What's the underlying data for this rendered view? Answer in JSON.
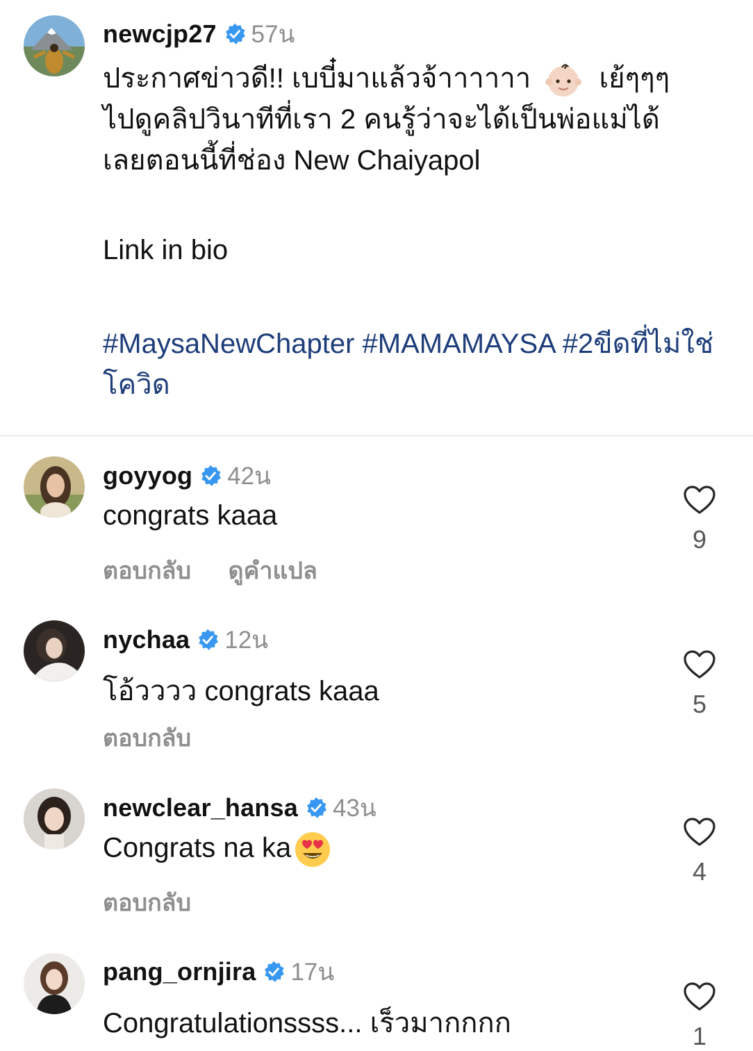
{
  "post": {
    "username": "newcjp27",
    "time": "57น",
    "caption_lines": [
      "ประกาศข่าวดี!! เบบี๋มาแล้วจ้าาาาาา",
      "เย้ๆๆๆ",
      "ไปดูคลิปวินาทีที่เรา 2 คนรู้ว่าจะได้เป็นพ่อแม่ได้",
      "เลยตอนนี้ที่ช่อง New Chaiyapol"
    ],
    "link_text": "Link in bio",
    "hashtags": [
      "#MaysaNewChapter",
      "#MAMAMAYSA",
      "#2ขีดที่ไม่ใช่โควิด"
    ],
    "emoji_icon": "baby-face-emoji"
  },
  "comments": [
    {
      "username": "goyyog",
      "time": "42น",
      "text": "congrats kaaa",
      "reply_label": "ตอบกลับ",
      "translate_label": "ดูคำแปล",
      "likes": "9"
    },
    {
      "username": "nychaa",
      "time": "12น",
      "text": "โอ้วววว congrats kaaa",
      "reply_label": "ตอบกลับ",
      "likes": "5"
    },
    {
      "username": "newclear_hansa",
      "time": "43น",
      "text": "Congrats na ka",
      "emoji_icon": "heart-eyes-emoji",
      "reply_label": "ตอบกลับ",
      "likes": "4"
    },
    {
      "username": "pang_ornjira",
      "time": "17น",
      "text": "Congratulationssss... เร็วมากกกก",
      "likes": "1"
    }
  ],
  "colors": {
    "verified": "#3897f0",
    "hashtag": "#1d3d7a",
    "muted": "#8e8e8e"
  }
}
